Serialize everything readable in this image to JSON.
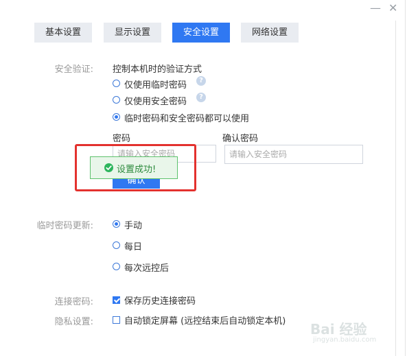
{
  "window": {
    "minimize_label": "—",
    "close_label": "✕"
  },
  "tabs": [
    {
      "label": "基本设置",
      "active": false
    },
    {
      "label": "显示设置",
      "active": false
    },
    {
      "label": "安全设置",
      "active": true
    },
    {
      "label": "网络设置",
      "active": false
    }
  ],
  "security_verification": {
    "label": "安全验证:",
    "description": "控制本机时的验证方式",
    "help_glyph": "?",
    "options": [
      {
        "label": "仅使用临时密码",
        "selected": false
      },
      {
        "label": "仅使用安全密码",
        "selected": false
      },
      {
        "label": "临时密码和安全密码都可以使用",
        "selected": true
      }
    ]
  },
  "password": {
    "label": "密码",
    "placeholder": "请输入安全密码"
  },
  "confirm_password": {
    "label": "确认密码",
    "placeholder": "请输入安全密码"
  },
  "confirm_button": {
    "label": "确认"
  },
  "toast": {
    "text": "设置成功!",
    "icon": "check-circle-icon",
    "color": "#2db55d"
  },
  "highlight_color": "#e3312e",
  "temp_password_update": {
    "label": "临时密码更新:",
    "options": [
      {
        "label": "手动",
        "selected": true
      },
      {
        "label": "每日",
        "selected": false
      },
      {
        "label": "每次远控后",
        "selected": false
      }
    ]
  },
  "connection_password": {
    "label": "连接密码:",
    "checkbox_label": "保存历史连接密码",
    "checked": true
  },
  "privacy": {
    "label": "隐私设置:",
    "checkbox_label": "自动锁定屏幕 (远控结束后自动锁定本机)",
    "checked": false
  },
  "watermark": {
    "brand": "Bai 经验",
    "url": "jingyan.baidu.com"
  },
  "accent_color": "#2f78f2"
}
